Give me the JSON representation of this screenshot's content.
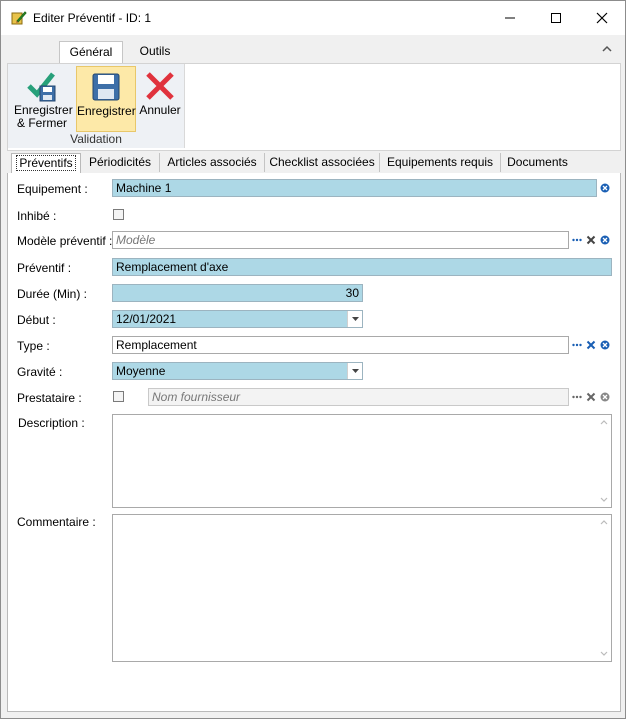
{
  "window": {
    "title": "Editer Préventif - ID: 1"
  },
  "ribbon": {
    "tabs": [
      "Général",
      "Outils"
    ],
    "buttons": {
      "save_close": "Enregistrer\n& Fermer",
      "save": "Enregistrer",
      "cancel": "Annuler"
    },
    "group_label": "Validation"
  },
  "tabs": [
    "Préventifs",
    "Périodicités",
    "Articles associés",
    "Checklist associées",
    "Equipements requis",
    "Documents"
  ],
  "form": {
    "equipement": {
      "label": "Equipement :",
      "value": "Machine 1"
    },
    "inhibe": {
      "label": "Inhibé :"
    },
    "modele": {
      "label": "Modèle préventif :",
      "placeholder": "Modèle"
    },
    "preventif": {
      "label": "Préventif :",
      "value": "Remplacement d'axe"
    },
    "duree": {
      "label": "Durée (Min) :",
      "value": "30"
    },
    "debut": {
      "label": "Début :",
      "value": "12/01/2021"
    },
    "type": {
      "label": "Type :",
      "value": "Remplacement"
    },
    "gravite": {
      "label": "Gravité :",
      "value": "Moyenne"
    },
    "prestataire": {
      "label": "Prestataire :",
      "placeholder": "Nom fournisseur"
    },
    "description": {
      "label": "Description :"
    },
    "commentaire": {
      "label": "Commentaire :"
    }
  },
  "colors": {
    "highlight": "#add8e6",
    "accent_blue": "#1a5fb4",
    "save_bg": "#fde9a8"
  }
}
